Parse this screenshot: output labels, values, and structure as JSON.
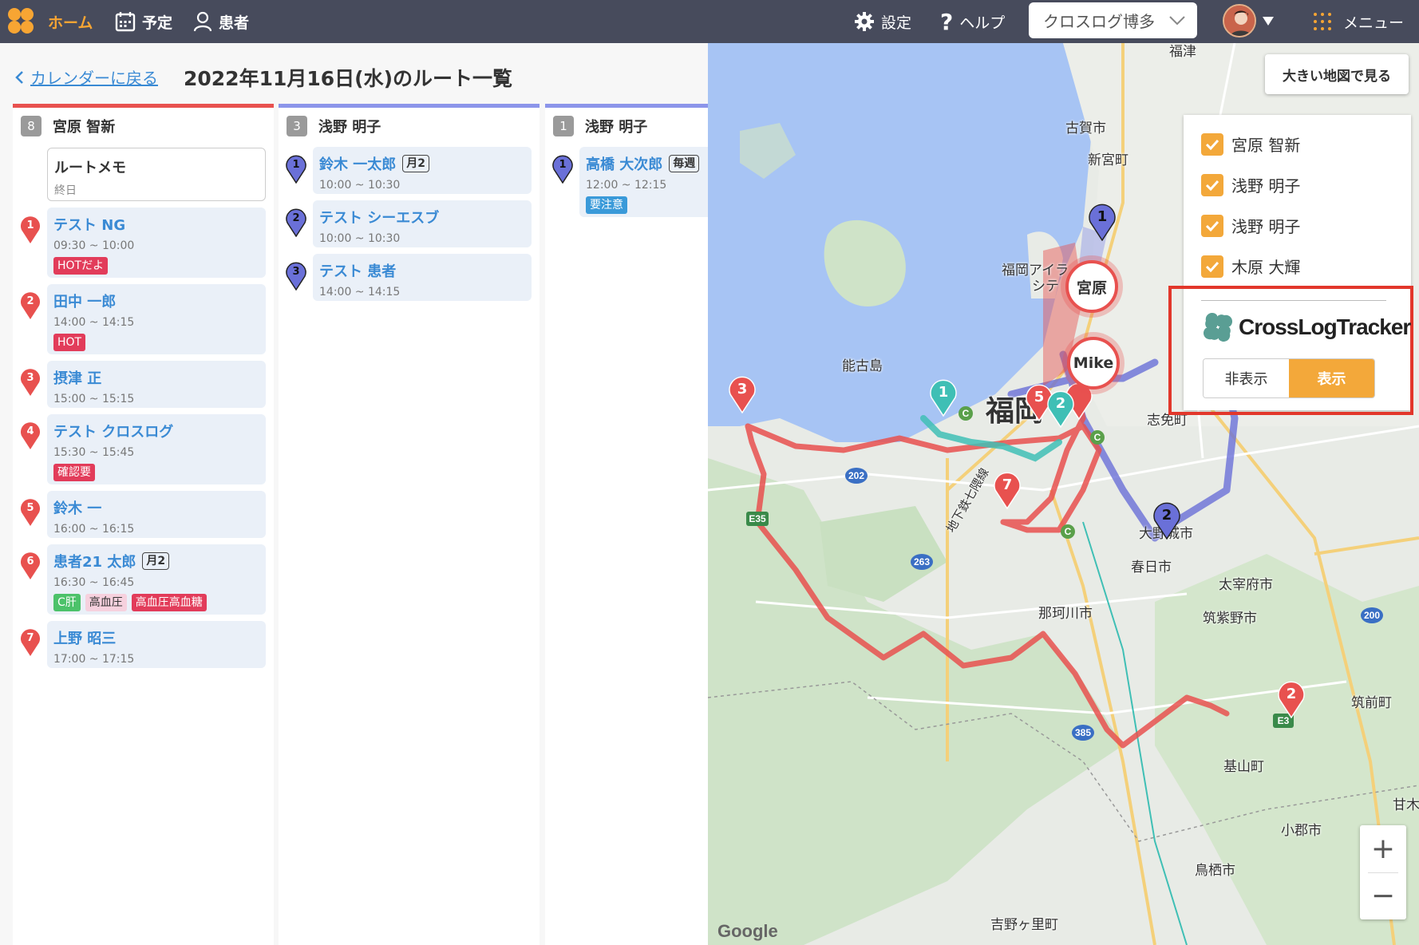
{
  "nav": {
    "home": "ホーム",
    "schedule": "予定",
    "patients": "患者",
    "settings": "設定",
    "help": "ヘルプ",
    "org_selected": "クロスログ博多",
    "menu": "メニュー",
    "accent": "#f7a533"
  },
  "header": {
    "back_label": "カレンダーに戻る",
    "title": "2022年11月16日(水)のルート一覧"
  },
  "columns": [
    {
      "count": "8",
      "name": "宮原 智新",
      "bar_color": "#e8514f",
      "memo": {
        "title": "ルートメモ",
        "sub": "終日"
      },
      "visits": [
        {
          "num": "1",
          "name": "テスト NG",
          "freq": "",
          "time": "09:30 ~ 10:00",
          "tags": [
            "HOTだよ"
          ]
        },
        {
          "num": "2",
          "name": "田中 一郎",
          "freq": "",
          "time": "14:00 ~ 14:15",
          "tags": [
            "HOT"
          ]
        },
        {
          "num": "3",
          "name": "摂津 正",
          "freq": "",
          "time": "15:00 ~ 15:15",
          "tags": []
        },
        {
          "num": "4",
          "name": "テスト クロスログ",
          "freq": "",
          "time": "15:30 ~ 15:45",
          "tags": [
            "確認要"
          ]
        },
        {
          "num": "5",
          "name": "鈴木 一",
          "freq": "",
          "time": "16:00 ~ 16:15",
          "tags": []
        },
        {
          "num": "6",
          "name": "患者21 太郎",
          "freq": "月2",
          "time": "16:30 ~ 16:45",
          "tags": [
            "C肝",
            "高血圧",
            "高血圧高血糖"
          ]
        },
        {
          "num": "7",
          "name": "上野 昭三",
          "freq": "",
          "time": "17:00 ~ 17:15",
          "tags": []
        }
      ]
    },
    {
      "count": "3",
      "name": "浅野 明子",
      "bar_color": "#8c95ea",
      "visits": [
        {
          "num": "1",
          "name": "鈴木 一太郎",
          "freq": "月2",
          "time": "10:00 ~ 10:30",
          "tags": []
        },
        {
          "num": "2",
          "name": "テスト シーエスブ",
          "freq": "",
          "time": "10:00 ~ 10:30",
          "tags": []
        },
        {
          "num": "3",
          "name": "テスト 患者",
          "freq": "",
          "time": "14:00 ~ 14:15",
          "tags": []
        }
      ]
    },
    {
      "count": "1",
      "name": "浅野 明子",
      "bar_color": "#8c95ea",
      "visits": [
        {
          "num": "1",
          "name": "高橋 大次郎",
          "freq": "毎週",
          "time": "12:00 ~ 12:15",
          "tags": [
            "要注意"
          ]
        }
      ]
    }
  ],
  "map": {
    "big_map_button": "大きい地図で見る",
    "filters": [
      "宮原 智新",
      "浅野 明子",
      "浅野 明子",
      "木原 大輝"
    ],
    "tracker_brand": "CrossLogTracker",
    "toggle_off": "非表示",
    "toggle_on": "表示",
    "user_bubbles": [
      "宮原",
      "Mike"
    ],
    "labels": {
      "fukuoka": "福岡",
      "koga": "古賀市",
      "shingu": "新宮町",
      "island_city": "福岡アイラ",
      "island_city2": "シテ",
      "nokonoshima": "能古島",
      "shime": "志免町",
      "onojo": "大野城市",
      "kasuga": "春日市",
      "dazaifu": "太宰府市",
      "chikushino": "筑紫野市",
      "nakagawa": "那珂川市",
      "chikuzen": "筑前町",
      "kiyama": "基山町",
      "ogori": "小郡市",
      "tosu": "鳥栖市",
      "yoshinogari": "吉野ヶ里町",
      "subway": "地下鉄七隈線",
      "fukuma": "福津",
      "amagi": "甘木"
    },
    "shields": [
      "202",
      "263",
      "385",
      "E3",
      "E35",
      "200",
      "C"
    ],
    "google": "Google",
    "zoom_in": "+",
    "zoom_out": "−"
  },
  "colors": {
    "route_red": "#e8514f",
    "route_blue": "#6a70d8",
    "route_teal": "#3fbfb5",
    "water": "#a7c4f4",
    "land": "#e8ebe6"
  }
}
